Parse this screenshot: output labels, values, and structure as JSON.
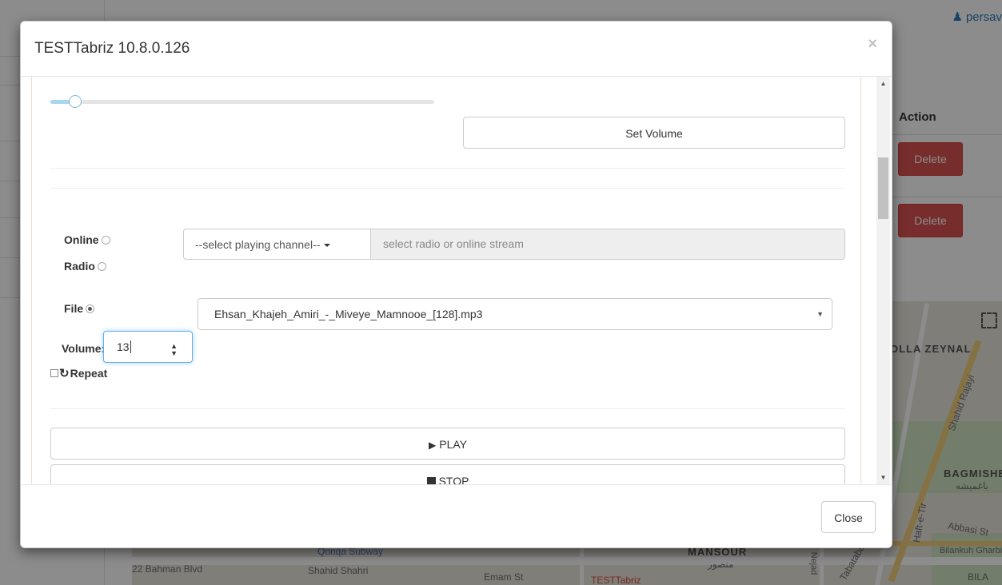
{
  "background": {
    "user_name": "persav",
    "action_header": "Action",
    "delete_labels": [
      "Delete",
      "Delete"
    ],
    "map_labels": {
      "olla_zeynal": "OLLA ZEYNAL",
      "shahid_rajayi": "Shahid Rajayi",
      "bagmishe": "BAGMISHE",
      "bagmishe_fa": "باغمیشه",
      "abbasi_st": "Abbasi St",
      "haft_e_tir": "Haft-e-Tir",
      "bilankuh_gharbi": "Bilankuh Gharbi",
      "bila": "BILA",
      "mansour": "MANSOUR",
      "mansour_fa": "منصور",
      "qonqa_subway": "Qonqa Subway",
      "bahman_blvd": "22 Bahman Blvd",
      "shahid_shahri": "Shahid Shahri",
      "emam_st": "Emam St",
      "testtabriz": "TESTTabriz",
      "nejad": "Nejad",
      "tabataba": "Tabataba"
    }
  },
  "modal": {
    "title": "TESTTabriz 10.8.0.126",
    "close_x": "×",
    "volume": {
      "slider_level_fraction": 0.13,
      "set_volume_label": "Set Volume"
    },
    "source": {
      "online_label": "Online",
      "radio_label": "Radio",
      "file_label": "File",
      "selected": "File",
      "channel_dropdown_label": "--select playing channel--",
      "stream_placeholder": "select radio or online stream",
      "file_selected": "Ehsan_Khajeh_Amiri_-_Miveye_Mamnooe_[128].mp3"
    },
    "volume_field": {
      "label": "Volume:",
      "value": "13"
    },
    "repeat_label": "Repeat",
    "play_label": "PLAY",
    "stop_label": "STOP",
    "close_label": "Close"
  },
  "colors": {
    "accent_blue": "#66afe9",
    "delete_red": "#d9534f",
    "slider_fill": "#a6d8f0"
  }
}
